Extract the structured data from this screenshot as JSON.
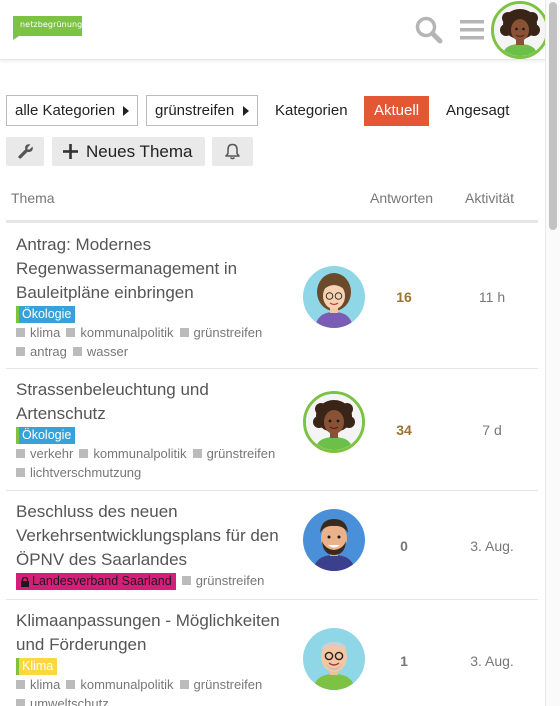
{
  "header": {
    "logo_text": "netzbegrünung",
    "brand_color": "#7dc242",
    "icons": [
      "search-icon",
      "hamburger-menu-icon",
      "user-avatar"
    ]
  },
  "nav": {
    "category_dropdown": "alle Kategorien",
    "tag_dropdown": "grünstreifen",
    "links": [
      "Kategorien",
      "Aktuell",
      "Angesagt"
    ],
    "active": "Aktuell",
    "active_color": "#e45735"
  },
  "actions": {
    "new_topic_label": "Neues Thema",
    "icons": [
      "wrench-icon",
      "plus-icon",
      "bell-icon"
    ]
  },
  "table": {
    "headers": {
      "topic": "Thema",
      "replies": "Antworten",
      "activity": "Aktivität"
    },
    "rows": [
      {
        "title": "Antrag: Modernes Regenwassermanagement in Bauleitpläne einbringen",
        "category": "Ökologie",
        "tags": [
          "klima",
          "kommunalpolitik",
          "grünstreifen",
          "antrag",
          "wasser"
        ],
        "replies": "16",
        "activity": "11 h",
        "replies_color": "#9c7230"
      },
      {
        "title": "Strassenbeleuchtung und Artenschutz",
        "category": "Ökologie",
        "tags": [
          "verkehr",
          "kommunalpolitik",
          "grünstreifen",
          "lichtverschmutzung"
        ],
        "replies": "34",
        "activity": "7 d",
        "replies_color": "#9c7230"
      },
      {
        "title": "Beschluss des neuen Verkehrsentwicklungsplans für den ÖPNV des Saarlandes",
        "category": "Landesverband Saarland",
        "tags": [
          "grünstreifen"
        ],
        "replies": "0",
        "activity": "3. Aug.",
        "replies_color": "#777777"
      },
      {
        "title": "Klimaanpassungen - Möglichkeiten und Förderungen",
        "category": "Klima",
        "tags": [
          "klima",
          "kommunalpolitik",
          "grünstreifen",
          "umweltschutz"
        ],
        "replies": "1",
        "activity": "3. Aug.",
        "replies_color": "#777777"
      }
    ]
  }
}
